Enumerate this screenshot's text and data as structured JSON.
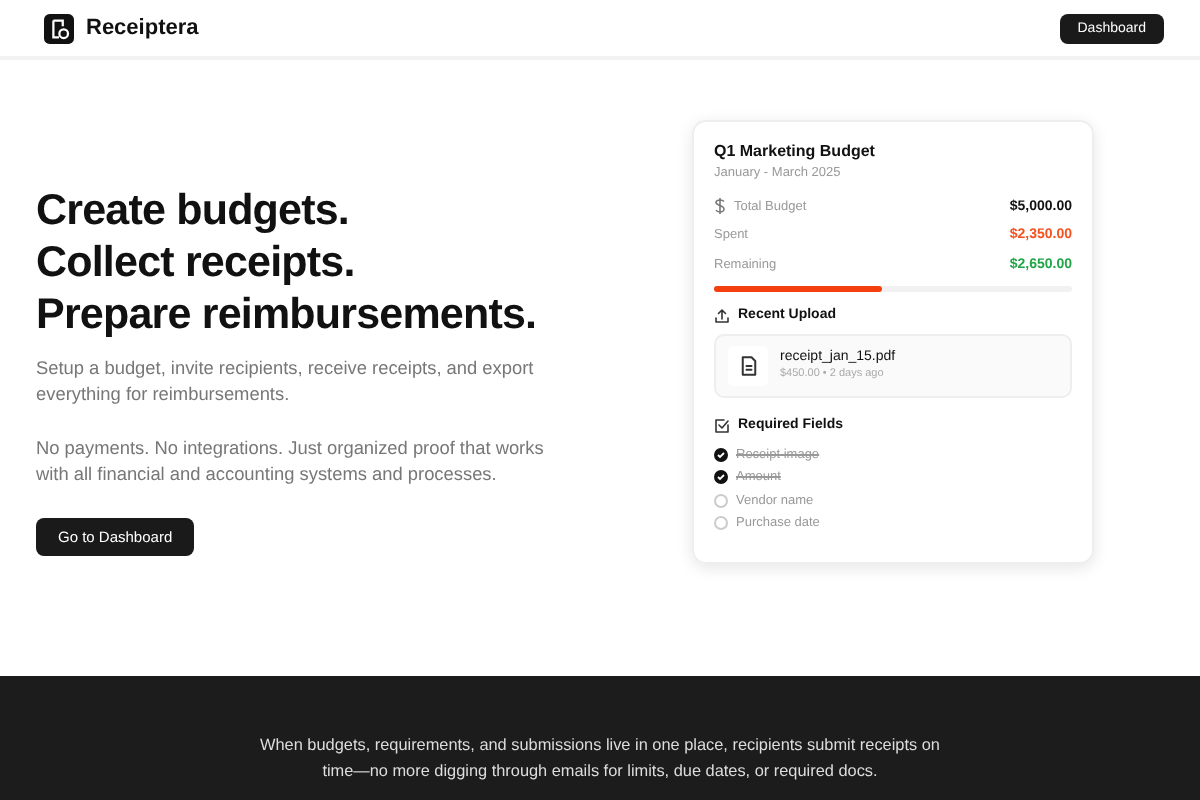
{
  "header": {
    "brand": "Receiptera",
    "button": "Dashboard"
  },
  "hero": {
    "headlines": [
      "Create budgets.",
      "Collect receipts.",
      "Prepare reimbursements."
    ],
    "paragraphs": [
      "Setup a budget, invite recipients, receive receipts, and export everything for reimbursements.",
      "No payments. No integrations. Just organized proof that works with all financial and accounting systems and processes."
    ],
    "button": "Go to Dashboard"
  },
  "card": {
    "title": "Q1 Marketing Budget",
    "subtitle": "January - March 2025",
    "rows": [
      {
        "label": "Total Budget",
        "value": "$5,000.00",
        "color": "#111111",
        "icon": true
      },
      {
        "label": "Spent",
        "value": "$2,350.00",
        "color": "#f4511e",
        "icon": false
      },
      {
        "label": "Remaining",
        "value": "$2,650.00",
        "color": "#22a447",
        "icon": false
      }
    ],
    "progress": {
      "level": 0.47
    },
    "upload_heading": "Recent Upload",
    "upload": {
      "name": "receipt_jan_15.pdf",
      "meta": "$450.00 • 2 days ago"
    },
    "fields_heading": "Required Fields",
    "fields": [
      {
        "label": "Receipt image",
        "checked": true
      },
      {
        "label": "Amount",
        "checked": true
      },
      {
        "label": "Vendor name",
        "checked": false
      },
      {
        "label": "Purchase date",
        "checked": false
      }
    ]
  },
  "footer": {
    "text": "When budgets, requirements, and submissions live in one place, recipients submit receipts on time—no more digging through emails for limits, due dates, or required docs."
  }
}
